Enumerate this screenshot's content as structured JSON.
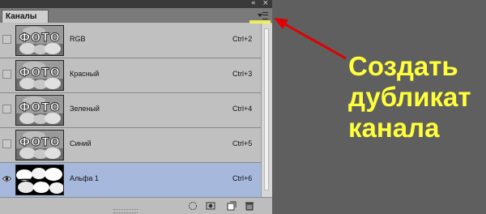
{
  "panel": {
    "tab_label": "Каналы",
    "window_controls": {
      "collapse": "«",
      "close": "×"
    },
    "channels": [
      {
        "name": "RGB",
        "shortcut": "Ctrl+2",
        "visible": false,
        "selected": false,
        "thumbnail": "photo-text-fist"
      },
      {
        "name": "Красный",
        "shortcut": "Ctrl+3",
        "visible": false,
        "selected": false,
        "thumbnail": "photo-text-fist"
      },
      {
        "name": "Зеленый",
        "shortcut": "Ctrl+4",
        "visible": false,
        "selected": false,
        "thumbnail": "photo-text-fist"
      },
      {
        "name": "Синий",
        "shortcut": "Ctrl+5",
        "visible": false,
        "selected": false,
        "thumbnail": "photo-text-fist"
      },
      {
        "name": "Альфа 1",
        "shortcut": "Ctrl+6",
        "visible": true,
        "selected": true,
        "thumbnail": "alpha-mask"
      }
    ],
    "thumb_text": "ФОТО",
    "footer_icons": [
      "load-selection-icon",
      "save-selection-icon",
      "new-channel-icon",
      "trash-icon"
    ]
  },
  "annotation": {
    "lines": [
      "Создать",
      "дубликат",
      "канала"
    ],
    "color": "#ffff3a",
    "arrow_color": "#e00000"
  }
}
